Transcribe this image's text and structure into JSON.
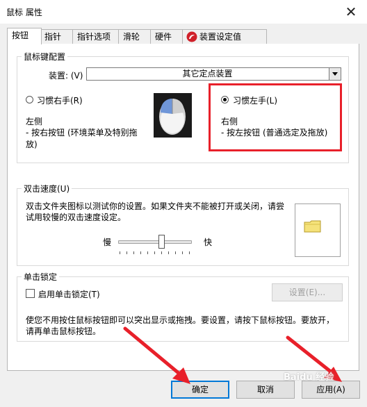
{
  "window": {
    "title": "鼠标 属性",
    "close_glyph": "✕"
  },
  "tabs": [
    {
      "label": "按钮"
    },
    {
      "label": "指针"
    },
    {
      "label": "指针选项"
    },
    {
      "label": "滑轮"
    },
    {
      "label": "硬件"
    },
    {
      "label": "装置设定值"
    }
  ],
  "button_config": {
    "group_label": "鼠标键配置",
    "device_label": "装置: (V)",
    "device_value": "其它定点装置",
    "right_handed_label": "习惯右手(R)",
    "left_handed_label": "习惯左手(L)",
    "selected": "left",
    "left_side_title": "左侧",
    "left_side_desc_line1": " - 按右按钮 (环境菜单及特别拖",
    "left_side_desc_line2": "放)",
    "right_side_title": "右侧",
    "right_side_desc": " - 按左按钮 (普通选定及拖放)"
  },
  "double_click": {
    "group_label": "双击速度(U)",
    "desc_line1": "双击文件夹图标以测试你的设置。如果文件夹不能被打开或关闭，请尝",
    "desc_line2": "试用较慢的双击速度设定。",
    "slow_label": "慢",
    "fast_label": "快",
    "speed_fraction": 0.6
  },
  "click_lock": {
    "group_label": "单击锁定",
    "checkbox_label": "启用单击锁定(T)",
    "checked": false,
    "settings_button": "设置(E)...",
    "desc_line1": "使您不用按住鼠标按钮即可以突出显示或拖拽。要设置，请按下鼠标按钮。要放开，",
    "desc_line2": "请再单击鼠标按钮。"
  },
  "footer": {
    "ok_label": "确定",
    "cancel_label": "取消",
    "apply_label": "应用(A)"
  },
  "watermark": "Baidu 经验",
  "colors": {
    "annotation_red": "#e8202a",
    "folder_yellow": "#f5e27a"
  },
  "icons": [
    "close-icon",
    "dropdown-arrow-icon",
    "device-settings-icon",
    "mouse-icon",
    "folder-icon"
  ]
}
